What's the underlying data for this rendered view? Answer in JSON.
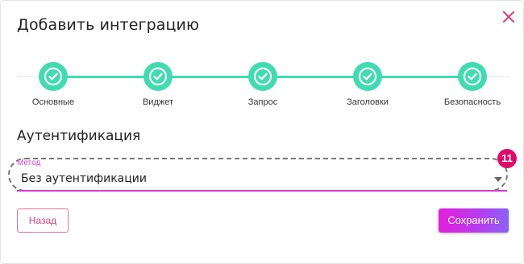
{
  "dialog": {
    "title": "Добавить интеграцию",
    "close_icon": "close-icon"
  },
  "stepper": {
    "steps": [
      {
        "label": "Основные",
        "status": "completed"
      },
      {
        "label": "Виджет",
        "status": "completed"
      },
      {
        "label": "Запрос",
        "status": "completed"
      },
      {
        "label": "Заголовки",
        "status": "completed"
      },
      {
        "label": "Безопасность",
        "status": "completed"
      }
    ],
    "step_icon": "check-circle-icon"
  },
  "section": {
    "title": "Аутентификация"
  },
  "method_field": {
    "label": "Метод",
    "value": "Без аутентификации",
    "badge": "11"
  },
  "buttons": {
    "back_label": "Назад",
    "save_label": "Сохранить"
  },
  "colors": {
    "step_accent": "#3fdcb1",
    "close_icon": "#e0457f",
    "field_accent": "#d63cc8",
    "badge": "#e2086a",
    "save_gradient_start": "#e41edc",
    "save_gradient_end": "#8a63f5"
  }
}
